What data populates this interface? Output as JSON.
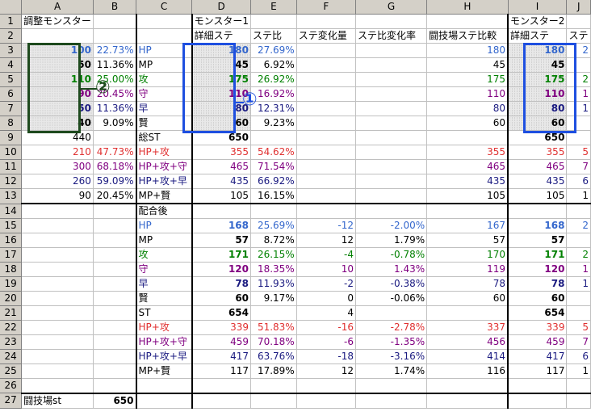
{
  "columns": [
    "A",
    "B",
    "C",
    "D",
    "E",
    "F",
    "G",
    "H",
    "I",
    "J"
  ],
  "rows": [
    {
      "n": "1",
      "cells": [
        "調整モンスター",
        "",
        "",
        "モンスター1",
        "",
        "",
        "",
        "",
        "モンスター2",
        ""
      ]
    },
    {
      "n": "2",
      "cells": [
        "",
        "",
        "",
        "詳細ステ",
        "ステ比",
        "ステ変化量",
        "ステ比変化率",
        "闘技場ステ比較",
        "詳細ステ",
        "ステ"
      ]
    },
    {
      "n": "3",
      "cells": [
        "100",
        "22.73%",
        "HP",
        "180",
        "27.69%",
        "",
        "",
        "180",
        "180",
        "2"
      ]
    },
    {
      "n": "4",
      "cells": [
        "50",
        "11.36%",
        "MP",
        "45",
        "6.92%",
        "",
        "",
        "45",
        "45",
        ""
      ]
    },
    {
      "n": "5",
      "cells": [
        "110",
        "25.00%",
        "攻",
        "175",
        "26.92%",
        "",
        "",
        "175",
        "175",
        "2"
      ]
    },
    {
      "n": "6",
      "cells": [
        "90",
        "20.45%",
        "守",
        "110",
        "16.92%",
        "",
        "",
        "110",
        "110",
        "1"
      ]
    },
    {
      "n": "7",
      "cells": [
        "50",
        "11.36%",
        "早",
        "80",
        "12.31%",
        "",
        "",
        "80",
        "80",
        "1"
      ]
    },
    {
      "n": "8",
      "cells": [
        "40",
        "9.09%",
        "賢",
        "60",
        "9.23%",
        "",
        "",
        "60",
        "60",
        ""
      ]
    },
    {
      "n": "9",
      "cells": [
        "440",
        "",
        "総ST",
        "650",
        "",
        "",
        "",
        "",
        "650",
        ""
      ]
    },
    {
      "n": "10",
      "cells": [
        "210",
        "47.73%",
        "HP+攻",
        "355",
        "54.62%",
        "",
        "",
        "355",
        "355",
        "5"
      ]
    },
    {
      "n": "11",
      "cells": [
        "300",
        "68.18%",
        "HP+攻+守",
        "465",
        "71.54%",
        "",
        "",
        "465",
        "465",
        "7"
      ]
    },
    {
      "n": "12",
      "cells": [
        "260",
        "59.09%",
        "HP+攻+早",
        "435",
        "66.92%",
        "",
        "",
        "435",
        "435",
        "6"
      ]
    },
    {
      "n": "13",
      "cells": [
        "90",
        "20.45%",
        "MP+賢",
        "105",
        "16.15%",
        "",
        "",
        "105",
        "105",
        "1"
      ]
    },
    {
      "n": "14",
      "cells": [
        "",
        "",
        "配合後",
        "",
        "",
        "",
        "",
        "",
        "",
        ""
      ]
    },
    {
      "n": "15",
      "cells": [
        "",
        "",
        "HP",
        "168",
        "25.69%",
        "-12",
        "-2.00%",
        "167",
        "168",
        "2"
      ]
    },
    {
      "n": "16",
      "cells": [
        "",
        "",
        "MP",
        "57",
        "8.72%",
        "12",
        "1.79%",
        "57",
        "57",
        ""
      ]
    },
    {
      "n": "17",
      "cells": [
        "",
        "",
        "攻",
        "171",
        "26.15%",
        "-4",
        "-0.78%",
        "170",
        "171",
        "2"
      ]
    },
    {
      "n": "18",
      "cells": [
        "",
        "",
        "守",
        "120",
        "18.35%",
        "10",
        "1.43%",
        "119",
        "120",
        "1"
      ]
    },
    {
      "n": "19",
      "cells": [
        "",
        "",
        "早",
        "78",
        "11.93%",
        "-2",
        "-0.38%",
        "78",
        "78",
        "1"
      ]
    },
    {
      "n": "20",
      "cells": [
        "",
        "",
        "賢",
        "60",
        "9.17%",
        "0",
        "-0.06%",
        "60",
        "60",
        ""
      ]
    },
    {
      "n": "21",
      "cells": [
        "",
        "",
        "ST",
        "654",
        "",
        "4",
        "",
        "",
        "654",
        ""
      ]
    },
    {
      "n": "22",
      "cells": [
        "",
        "",
        "HP+攻",
        "339",
        "51.83%",
        "-16",
        "-2.78%",
        "337",
        "339",
        "5"
      ]
    },
    {
      "n": "23",
      "cells": [
        "",
        "",
        "HP+攻+守",
        "459",
        "70.18%",
        "-6",
        "-1.35%",
        "456",
        "459",
        "7"
      ]
    },
    {
      "n": "24",
      "cells": [
        "",
        "",
        "HP+攻+早",
        "417",
        "63.76%",
        "-18",
        "-3.16%",
        "414",
        "417",
        "6"
      ]
    },
    {
      "n": "25",
      "cells": [
        "",
        "",
        "MP+賢",
        "117",
        "17.89%",
        "12",
        "1.74%",
        "116",
        "117",
        "1"
      ]
    },
    {
      "n": "26",
      "cells": [
        "",
        "",
        "",
        "",
        "",
        "",
        "",
        "",
        "",
        ""
      ]
    },
    {
      "n": "27",
      "cells": [
        "闘技場st",
        "650",
        "",
        "",
        "",
        "",
        "",
        "",
        "",
        ""
      ]
    }
  ],
  "callouts": {
    "one": "①",
    "two": "②"
  },
  "colors": {
    "highlight_blue": "#1e4fe0",
    "highlight_green": "#1e4a1e"
  }
}
